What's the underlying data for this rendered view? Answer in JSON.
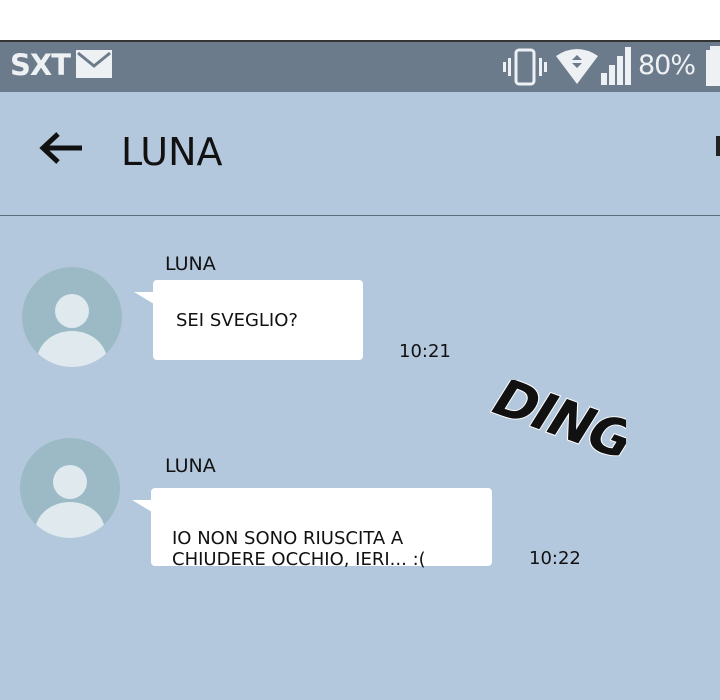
{
  "status_bar": {
    "carrier": "SXT",
    "battery": "80%",
    "icons": [
      "mail-icon",
      "vibrate-icon",
      "wifi-icon",
      "signal-icon",
      "battery-icon"
    ]
  },
  "header": {
    "back_icon": "back-arrow-icon",
    "title": "LUNA"
  },
  "messages": [
    {
      "sender": "LUNA",
      "text": "SEI SVEGLIO?",
      "time": "10:21"
    },
    {
      "sender": "LUNA",
      "text": "IO NON SONO RIUSCITA A\nCHIUDERE OCCHIO, IERI... :(",
      "time": "10:22"
    }
  ],
  "sound_effect": "DING",
  "colors": {
    "background": "#b3c8dc",
    "status_bar": "#6c7b8b",
    "avatar": "#9cbac6",
    "bubble": "#ffffff"
  }
}
